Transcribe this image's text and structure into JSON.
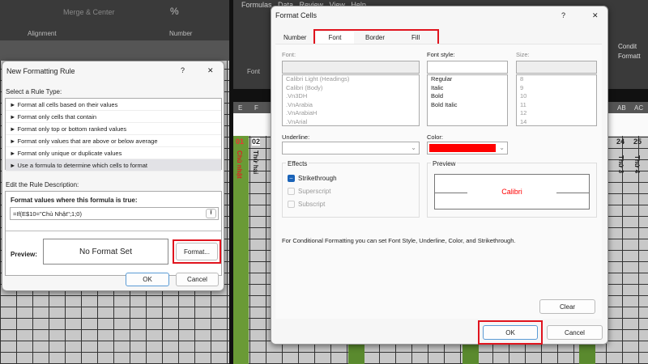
{
  "left": {
    "ribbon": {
      "merge_center": "Merge & Center",
      "alignment": "Alignment",
      "number": "Number"
    },
    "dialog": {
      "title": "New Formatting Rule",
      "help": "?",
      "close": "✕",
      "select_label": "Select a Rule Type:",
      "rule_types": [
        "Format all cells based on their values",
        "Format only cells that contain",
        "Format only top or bottom ranked values",
        "Format only values that are above or below average",
        "Format only unique or duplicate values",
        "Use a formula to determine which cells to format"
      ],
      "selected_index": 5,
      "edit_label": "Edit the Rule Description:",
      "formula_label": "Format values where this formula is true:",
      "formula_value": "=If(E$10=\"Chủ Nhật\";1;0)",
      "preview_label": "Preview:",
      "preview_text": "No Format Set",
      "format_button": "Format...",
      "ok": "OK",
      "cancel": "Cancel"
    }
  },
  "right": {
    "ribbon": {
      "menu": "Formulas   Data   Review   View   Help",
      "font_group": "Font",
      "cond_format": "Condit\nFormatt"
    },
    "columns": {
      "e": "E",
      "f": "F",
      "ab": "AB",
      "ac": "AC"
    },
    "days": {
      "d01": "01",
      "d02": "02",
      "d24": "24",
      "d25": "25",
      "w01": "Chủ nhật",
      "w02": "Thứ hai",
      "w24": "Thứ 3",
      "w25": "Thứ 4"
    },
    "dialog": {
      "title": "Format Cells",
      "help": "?",
      "close": "✕",
      "tabs": [
        "Number",
        "Font",
        "Border",
        "Fill"
      ],
      "active_tab": "Font",
      "font_label": "Font:",
      "fonts": [
        "Calibri Light (Headings)",
        "Calibri (Body)",
        ".Vn3DH",
        ".VnArabia",
        ".VnArabiaH",
        ".VnArial"
      ],
      "style_label": "Font style:",
      "styles": [
        "Regular",
        "Italic",
        "Bold",
        "Bold Italic"
      ],
      "size_label": "Size:",
      "sizes": [
        "8",
        "9",
        "10",
        "11",
        "12",
        "14"
      ],
      "underline_label": "Underline:",
      "color_label": "Color:",
      "color_value": "#ff0000",
      "effects_label": "Effects",
      "strikethrough": "Strikethrough",
      "superscript": "Superscript",
      "subscript": "Subscript",
      "preview_label": "Preview",
      "preview_text": "Calibri",
      "note": "For Conditional Formatting you can set Font Style, Underline, Color, and Strikethrough.",
      "clear": "Clear",
      "ok": "OK",
      "cancel": "Cancel"
    }
  }
}
